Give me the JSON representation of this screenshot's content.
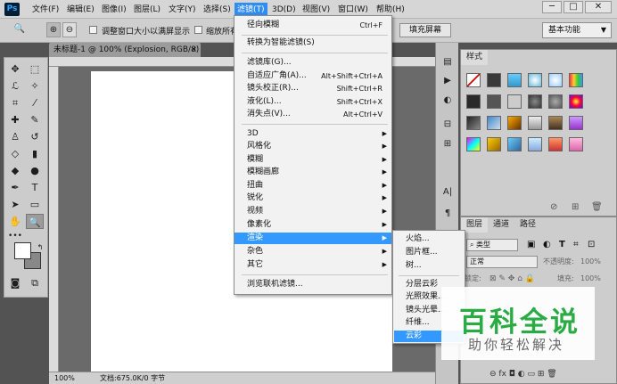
{
  "app": {
    "logo": "Ps"
  },
  "menubar": {
    "items": [
      "文件(F)",
      "编辑(E)",
      "图像(I)",
      "图层(L)",
      "文字(Y)",
      "选择(S)",
      "滤镜(T)",
      "3D(D)",
      "视图(V)",
      "窗口(W)",
      "帮助(H)"
    ],
    "active_index": 6,
    "window_controls": [
      "─",
      "□",
      "✕"
    ]
  },
  "options": {
    "resize_windows_label": "调整窗口大小以满屏显示",
    "zoom_all_windows_label": "缩放所有窗",
    "fill_screen_label": "填充屏幕",
    "workspace": "基本功能"
  },
  "document": {
    "tab_title": "未标题-1 @ 100% (Explosion, RGB/8) *",
    "tab_close": "×",
    "zoom": "100%",
    "doc_info": "文档:675.0K/0 字节"
  },
  "filter_menu": {
    "items": [
      {
        "label": "径向模糊",
        "shortcut": "Ctrl+F"
      },
      {
        "label": "转换为智能滤镜(S)"
      },
      {
        "label": "滤镜库(G)..."
      },
      {
        "label": "自适应广角(A)...",
        "shortcut": "Alt+Shift+Ctrl+A"
      },
      {
        "label": "镜头校正(R)...",
        "shortcut": "Shift+Ctrl+R"
      },
      {
        "label": "液化(L)...",
        "shortcut": "Shift+Ctrl+X"
      },
      {
        "label": "消失点(V)...",
        "shortcut": "Alt+Ctrl+V"
      },
      {
        "label": "3D",
        "submenu": true
      },
      {
        "label": "风格化",
        "submenu": true
      },
      {
        "label": "模糊",
        "submenu": true
      },
      {
        "label": "模糊画廊",
        "submenu": true
      },
      {
        "label": "扭曲",
        "submenu": true
      },
      {
        "label": "锐化",
        "submenu": true
      },
      {
        "label": "视频",
        "submenu": true
      },
      {
        "label": "像素化",
        "submenu": true
      },
      {
        "label": "渲染",
        "submenu": true,
        "highlighted": true
      },
      {
        "label": "杂色",
        "submenu": true
      },
      {
        "label": "其它",
        "submenu": true
      },
      {
        "label": "浏览联机滤镜..."
      }
    ]
  },
  "render_submenu": {
    "items": [
      {
        "label": "火焰..."
      },
      {
        "label": "图片框..."
      },
      {
        "label": "树..."
      },
      {
        "label": "分层云彩"
      },
      {
        "label": "光照效果..."
      },
      {
        "label": "镜头光晕..."
      },
      {
        "label": "纤维..."
      },
      {
        "label": "云彩",
        "highlighted": true
      }
    ]
  },
  "styles_panel": {
    "tab": "样式"
  },
  "layers_panel": {
    "tabs": [
      "图层",
      "通道",
      "路径"
    ],
    "kind_filter": "类型",
    "blend_mode": "正常",
    "opacity_label": "不透明度:",
    "opacity_value": "100%",
    "lock_label": "锁定:",
    "fill_label": "填充:",
    "fill_value": "100%"
  },
  "watermark": {
    "title": "百科全说",
    "subtitle": "助你轻松解决"
  },
  "colors": {
    "accent": "#3399ff",
    "watermark_green": "#2aab43",
    "canvas": "#ffffff",
    "workspace_bg": "#535353"
  }
}
